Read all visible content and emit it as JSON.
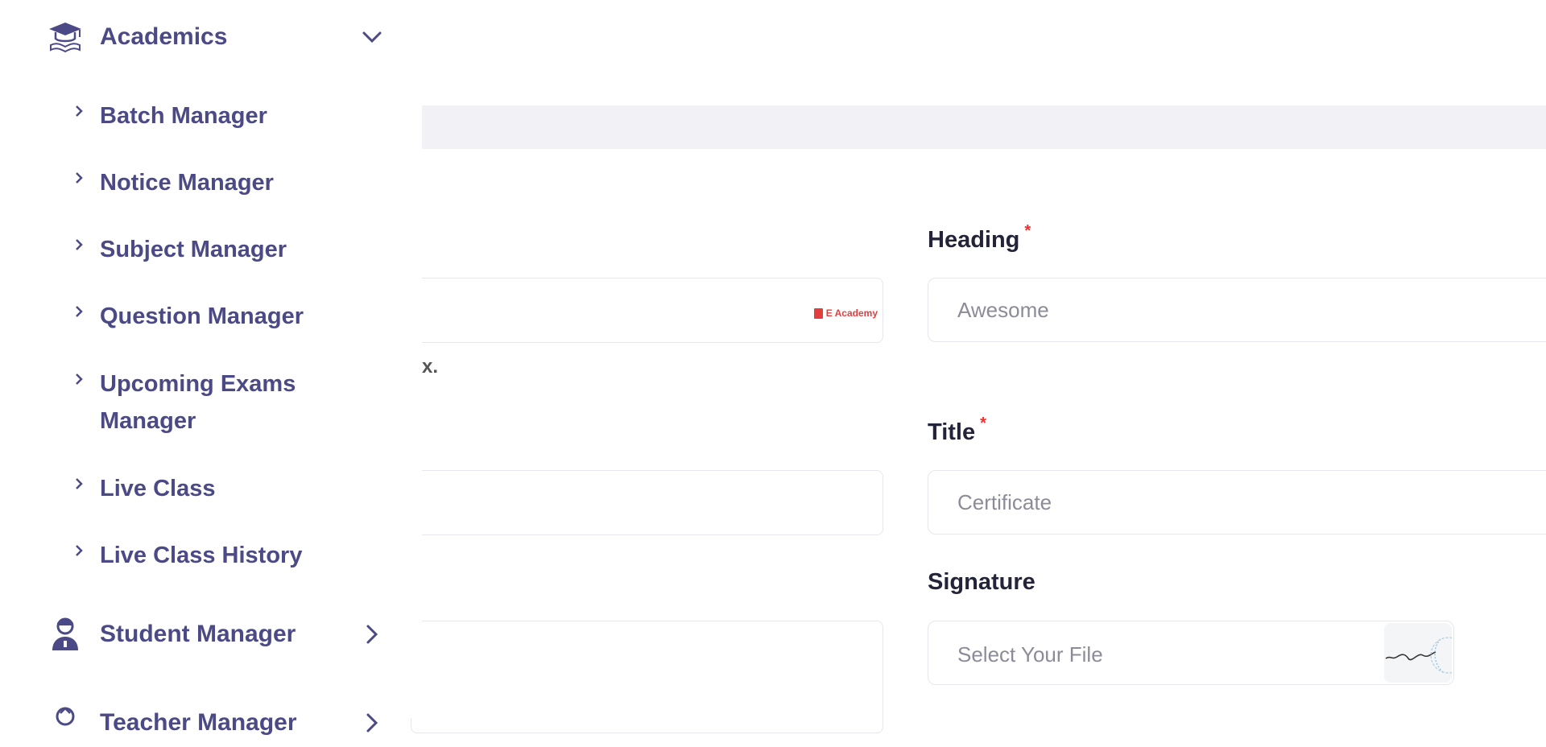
{
  "sidebar": {
    "academics": {
      "label": "Academics",
      "icon": "graduation-cap-icon"
    },
    "items": [
      {
        "label": "Batch Manager"
      },
      {
        "label": "Notice Manager"
      },
      {
        "label": "Subject Manager"
      },
      {
        "label": "Question Manager"
      },
      {
        "label": "Upcoming Exams Manager"
      },
      {
        "label": "Live Class"
      },
      {
        "label": "Live Class History"
      }
    ],
    "student_manager": {
      "label": "Student Manager",
      "icon": "student-icon"
    },
    "teacher_manager": {
      "label": "Teacher Manager",
      "icon": "teacher-icon"
    }
  },
  "form": {
    "logo_brand_text": "E Academy",
    "hint_fragment": "x.",
    "heading": {
      "label": "Heading",
      "required": "*",
      "placeholder": "Awesome"
    },
    "title": {
      "label": "Title",
      "required": "*",
      "placeholder": "Certificate"
    },
    "signature": {
      "label": "Signature",
      "file_placeholder": "Select Your File"
    }
  },
  "colors": {
    "accent": "#4b4a86",
    "required": "#ff2a2a",
    "band": "#f1f1f6"
  }
}
